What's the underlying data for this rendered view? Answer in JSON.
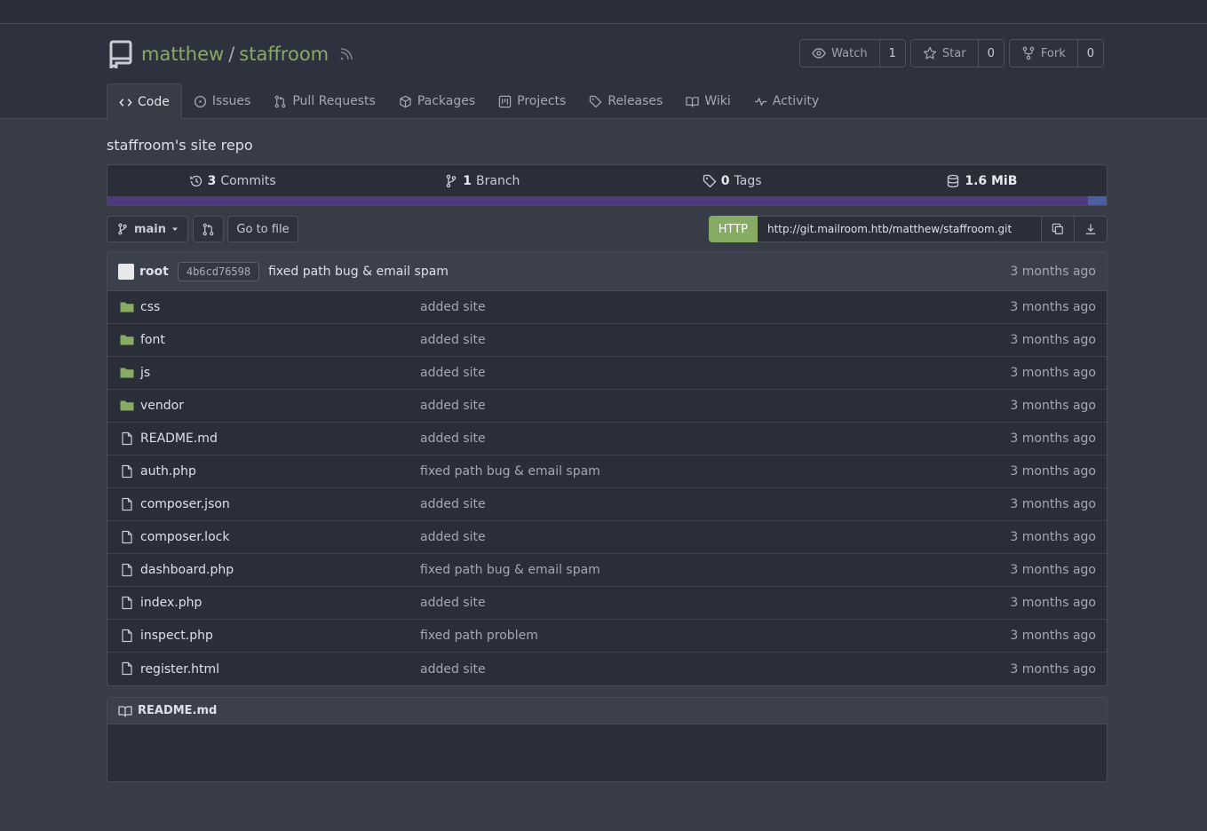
{
  "repo": {
    "owner": "matthew",
    "name": "staffroom",
    "description": "staffroom's site repo"
  },
  "actions": [
    {
      "label": "Watch",
      "count": "1",
      "icon": "eye-icon"
    },
    {
      "label": "Star",
      "count": "0",
      "icon": "star-icon"
    },
    {
      "label": "Fork",
      "count": "0",
      "icon": "fork-icon"
    }
  ],
  "tabs": [
    {
      "label": "Code",
      "icon": "code-icon",
      "active": true
    },
    {
      "label": "Issues",
      "icon": "issue-icon"
    },
    {
      "label": "Pull Requests",
      "icon": "pull-request-icon"
    },
    {
      "label": "Packages",
      "icon": "package-icon"
    },
    {
      "label": "Projects",
      "icon": "project-icon"
    },
    {
      "label": "Releases",
      "icon": "tag-icon"
    },
    {
      "label": "Wiki",
      "icon": "book-icon"
    },
    {
      "label": "Activity",
      "icon": "pulse-icon"
    }
  ],
  "stats": {
    "commits_count": "3",
    "commits_label": "Commits",
    "branch_count": "1",
    "branch_label": "Branch",
    "tags_count": "0",
    "tags_label": "Tags",
    "size": "1.6 MiB"
  },
  "language_colors": {
    "php": "#4f3a7f",
    "other": "#4a5ea0"
  },
  "toolbar": {
    "branch": "main",
    "go_to_file": "Go to file",
    "clone_protocol": "HTTP",
    "clone_url": "http://git.mailroom.htb/matthew/staffroom.git"
  },
  "latest_commit": {
    "author": "root",
    "sha": "4b6cd76598",
    "message": "fixed path bug & email spam",
    "time": "3 months ago"
  },
  "files": [
    {
      "type": "dir",
      "name": "css",
      "message": "added site",
      "time": "3 months ago"
    },
    {
      "type": "dir",
      "name": "font",
      "message": "added site",
      "time": "3 months ago"
    },
    {
      "type": "dir",
      "name": "js",
      "message": "added site",
      "time": "3 months ago"
    },
    {
      "type": "dir",
      "name": "vendor",
      "message": "added site",
      "time": "3 months ago"
    },
    {
      "type": "file",
      "name": "README.md",
      "message": "added site",
      "time": "3 months ago"
    },
    {
      "type": "file",
      "name": "auth.php",
      "message": "fixed path bug & email spam",
      "time": "3 months ago"
    },
    {
      "type": "file",
      "name": "composer.json",
      "message": "added site",
      "time": "3 months ago"
    },
    {
      "type": "file",
      "name": "composer.lock",
      "message": "added site",
      "time": "3 months ago"
    },
    {
      "type": "file",
      "name": "dashboard.php",
      "message": "fixed path bug & email spam",
      "time": "3 months ago"
    },
    {
      "type": "file",
      "name": "index.php",
      "message": "added site",
      "time": "3 months ago"
    },
    {
      "type": "file",
      "name": "inspect.php",
      "message": "fixed path problem",
      "time": "3 months ago"
    },
    {
      "type": "file",
      "name": "register.html",
      "message": "added site",
      "time": "3 months ago"
    }
  ],
  "readme": {
    "title": "README.md"
  },
  "colors": {
    "accent": "#87ab63",
    "background": "#383c47",
    "header": "#2e323e"
  }
}
